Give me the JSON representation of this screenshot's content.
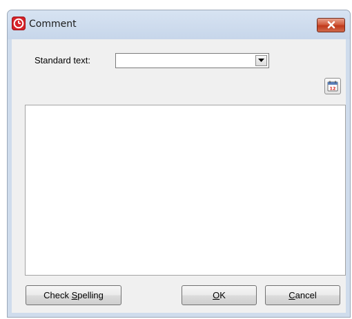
{
  "window": {
    "title": "Comment",
    "app_icon": "clock-icon",
    "close_icon": "close-icon"
  },
  "standard_text": {
    "label": "Standard text:",
    "value": "",
    "dropdown_icon": "chevron-down-icon"
  },
  "calendar_button": {
    "icon": "calendar-icon",
    "day": "12"
  },
  "comment": {
    "value": ""
  },
  "buttons": {
    "check_spelling": {
      "before": "Check ",
      "mnemonic": "S",
      "after": "pelling"
    },
    "ok": {
      "before": "",
      "mnemonic": "O",
      "after": "K"
    },
    "cancel": {
      "before": "",
      "mnemonic": "C",
      "after": "ancel"
    }
  },
  "colors": {
    "title_bar": "#cfdcec",
    "client": "#f0f0f0",
    "close_button": "#c9432a",
    "app_icon": "#d6232a"
  }
}
